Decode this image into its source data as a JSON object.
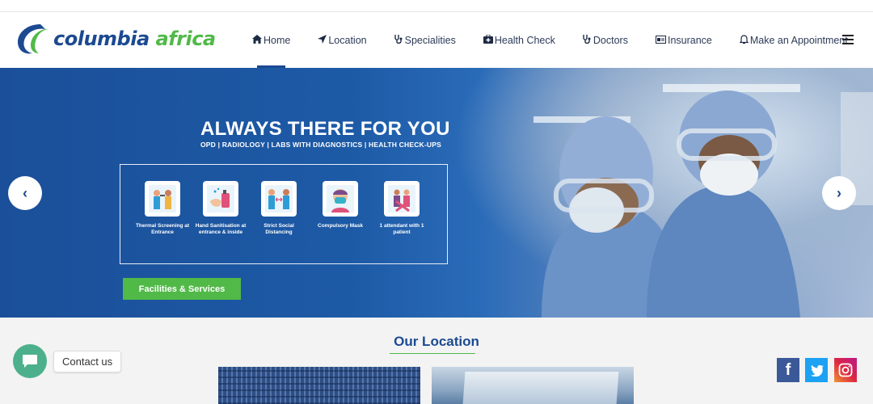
{
  "brand": {
    "name_part1": "columbia",
    "name_part2": "africa",
    "primary_color": "#1c4a91",
    "accent_color": "#51b948"
  },
  "nav": {
    "items": [
      {
        "label": "Home",
        "icon": "home-icon"
      },
      {
        "label": "Location",
        "icon": "location-arrow-icon"
      },
      {
        "label": "Specialities",
        "icon": "stethoscope-icon"
      },
      {
        "label": "Health Check",
        "icon": "medkit-icon"
      },
      {
        "label": "Doctors",
        "icon": "stethoscope-icon"
      },
      {
        "label": "Insurance",
        "icon": "id-card-icon"
      },
      {
        "label": "Make an Appointment",
        "icon": "bell-icon"
      }
    ],
    "active_index": 0
  },
  "hero": {
    "title": "ALWAYS THERE FOR YOU",
    "subtitle": "OPD | RADIOLOGY | LABS WITH DIAGNOSTICS | HEALTH CHECK-UPS",
    "measures": [
      {
        "label": "Thermal Screening at Entrance",
        "icon": "thermal-screening-icon"
      },
      {
        "label": "Hand Sanitisation at entrance & inside",
        "icon": "hand-sanitiser-icon"
      },
      {
        "label": "Strict Social Distancing",
        "icon": "social-distancing-icon"
      },
      {
        "label": "Compulsory Mask",
        "icon": "mask-icon"
      },
      {
        "label": "1 attendant with 1 patient",
        "icon": "one-attendant-icon"
      }
    ],
    "cta": "Facilities & Services",
    "prev_arrow": "‹",
    "next_arrow": "›"
  },
  "location": {
    "title": "Our Location"
  },
  "contact": {
    "label": "Contact us"
  },
  "social": [
    {
      "name": "facebook",
      "glyph": "f",
      "color": "#3b5998"
    },
    {
      "name": "twitter",
      "glyph": "t",
      "color": "#1da1f2"
    },
    {
      "name": "instagram",
      "glyph": "◎",
      "color": "#c13584"
    }
  ]
}
